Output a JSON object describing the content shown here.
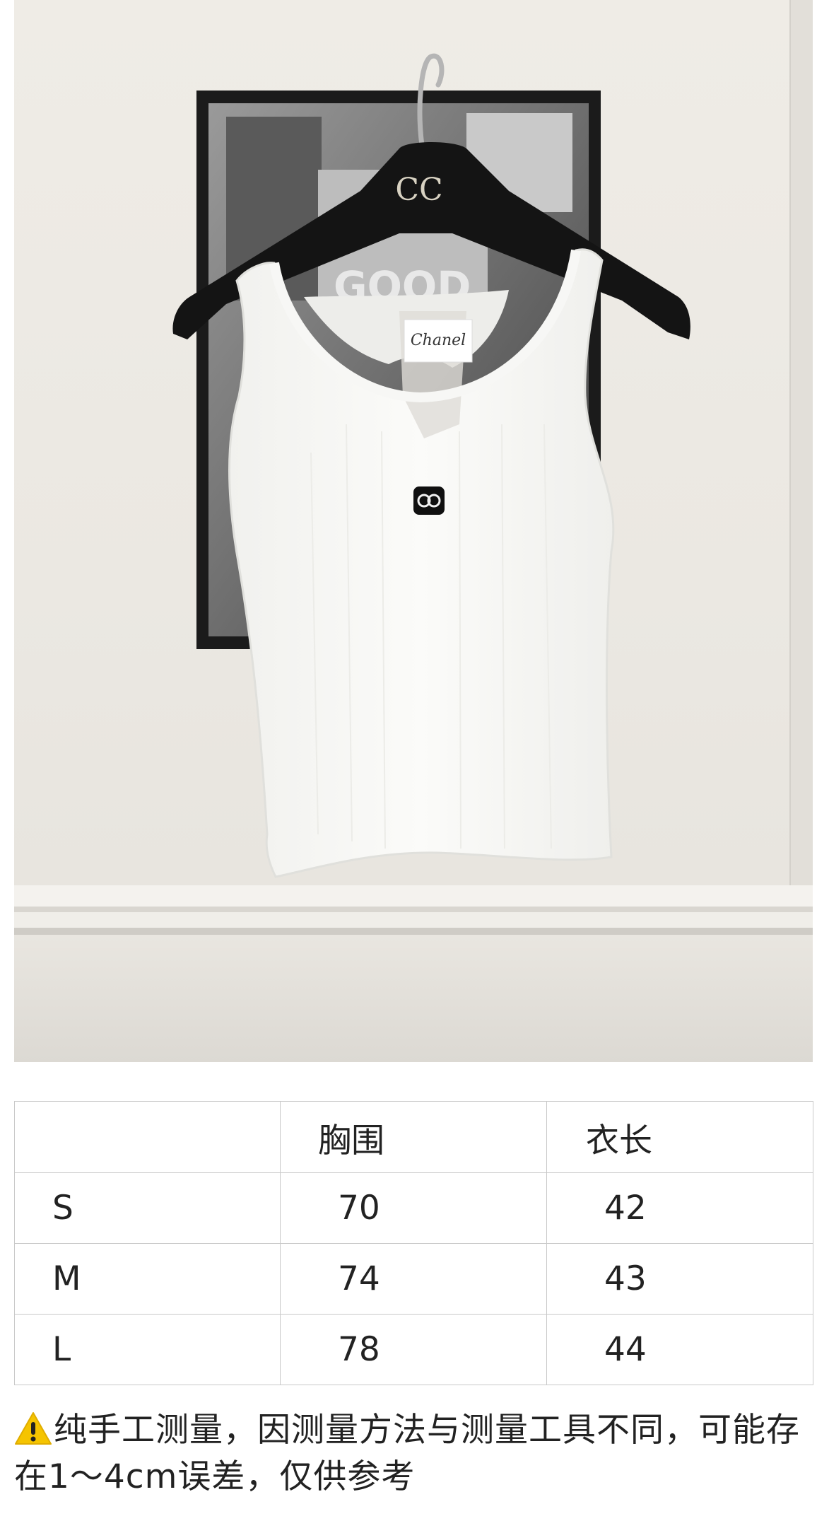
{
  "product_photo": {
    "hanger_logo_text": "CC",
    "frame_poster_text": "GOOD",
    "tag_text": "Chanel"
  },
  "size_table": {
    "headers": [
      "",
      "胸围",
      "衣长"
    ],
    "rows": [
      {
        "size": "S",
        "bust": "70",
        "length": "42"
      },
      {
        "size": "M",
        "bust": "74",
        "length": "43"
      },
      {
        "size": "L",
        "bust": "78",
        "length": "44"
      }
    ]
  },
  "note": {
    "icon": "warning-icon",
    "text": "纯手工测量，因测量方法与测量工具不同，可能存在1～4cm误差，仅供参考"
  },
  "colors": {
    "wall": "#ece9e3",
    "garment": "#fafaf8",
    "hanger": "#141414",
    "border": "#c9c9c9",
    "warning": "#f5c400"
  }
}
